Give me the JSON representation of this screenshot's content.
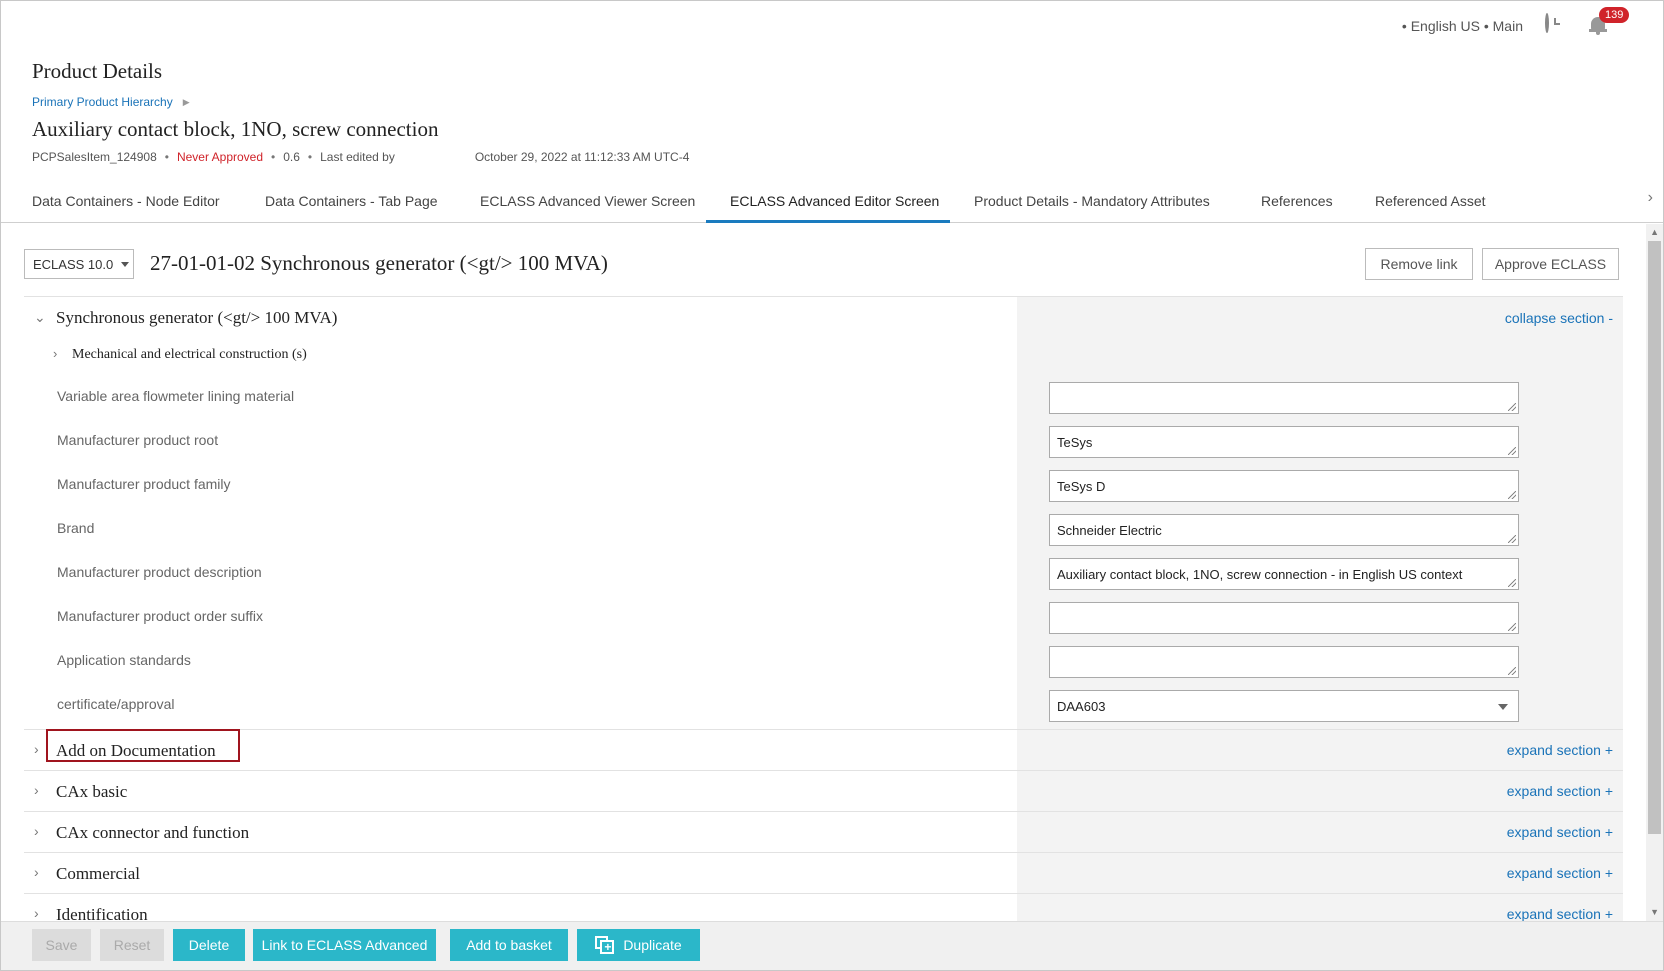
{
  "topbar": {
    "context": "• English US • Main",
    "notification_count": "139",
    "icons": [
      "history-icon",
      "bell-icon"
    ]
  },
  "header": {
    "page_title": "Product Details",
    "breadcrumb": "Primary Product Hierarchy",
    "product_name": "Auxiliary contact block, 1NO, screw connection",
    "meta": {
      "id": "PCPSalesItem_124908",
      "approval": "Never Approved",
      "version": "0.6",
      "last_edited": "Last edited by",
      "date": "October 29, 2022 at 11:12:33 AM UTC-4"
    }
  },
  "tabs": [
    {
      "label": "Data Containers - Node Editor"
    },
    {
      "label": "Data Containers - Tab Page"
    },
    {
      "label": "ECLASS Advanced Viewer Screen"
    },
    {
      "label": "ECLASS Advanced Editor Screen",
      "active": true
    },
    {
      "label": "Product Details - Mandatory Attributes"
    },
    {
      "label": "References"
    },
    {
      "label": "Referenced Asset"
    }
  ],
  "content": {
    "eclass_version": "ECLASS 10.0",
    "class_title": "27-01-01-02 Synchronous generator (<gt/> 100 MVA)",
    "remove_link": "Remove link",
    "approve": "Approve ECLASS"
  },
  "sections": [
    {
      "title": "Synchronous generator (<gt/> 100 MVA)",
      "action": "collapse section -"
    },
    {
      "title": "Add on Documentation",
      "action": "expand section +"
    },
    {
      "title": "CAx basic",
      "action": "expand section +"
    },
    {
      "title": "CAx connector and function",
      "action": "expand section +"
    },
    {
      "title": "Commercial",
      "action": "expand section +"
    },
    {
      "title": "Identification",
      "action": "expand section +"
    }
  ],
  "subsection": "Mechanical and electrical construction (s)",
  "attributes": [
    {
      "label": "Variable area flowmeter lining material",
      "value": ""
    },
    {
      "label": "Manufacturer product root",
      "value": "TeSys"
    },
    {
      "label": "Manufacturer product family",
      "value": "TeSys D"
    },
    {
      "label": "Brand",
      "value": "Schneider Electric"
    },
    {
      "label": "Manufacturer product description",
      "value": "Auxiliary contact block, 1NO, screw connection - in English US context"
    },
    {
      "label": "Manufacturer product order suffix",
      "value": ""
    },
    {
      "label": "Application standards",
      "value": ""
    },
    {
      "label": "certificate/approval",
      "value": "DAA603"
    }
  ],
  "toolbar": {
    "save": "Save",
    "reset": "Reset",
    "delete": "Delete",
    "link": "Link to ECLASS Advanced",
    "basket": "Add to basket",
    "duplicate": "Duplicate"
  },
  "colors": {
    "accent": "#2bb7c9",
    "link": "#1a73b8",
    "tab_active": "#1a7bbf",
    "warning": "#d0232a",
    "highlight": "#a0141e"
  }
}
